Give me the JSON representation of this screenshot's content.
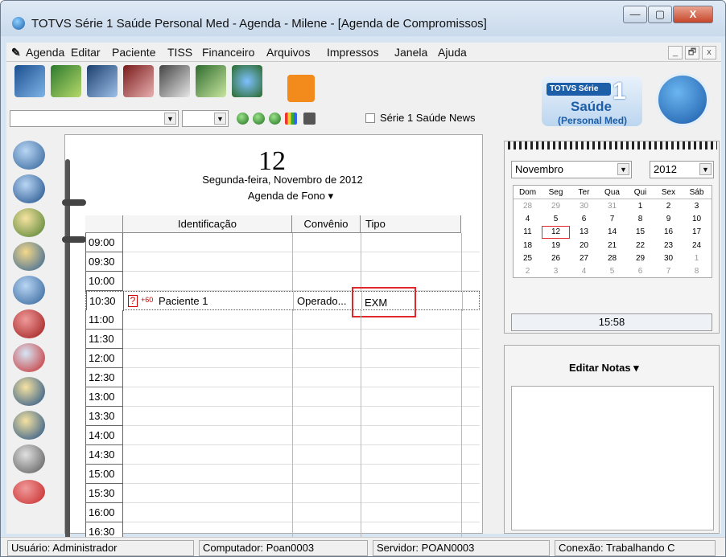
{
  "window": {
    "title": "TOTVS Série 1 Saúde Personal Med - Agenda - Milene - [Agenda de Compromissos]"
  },
  "window_buttons": {
    "minimize": "—",
    "maximize": "▢",
    "close": "X"
  },
  "menubar": {
    "items": [
      "Agenda",
      "Editar",
      "Paciente",
      "TISS",
      "Financeiro",
      "Arquivos",
      "Impressos",
      "Janela",
      "Ajuda"
    ],
    "mdi": [
      "_",
      "🗗",
      "x"
    ]
  },
  "toolbar": {
    "news_label": "Série 1 Saúde News"
  },
  "logo": {
    "brand": "TOTVS Série",
    "number": "1",
    "product": "Saúde",
    "edition": "(Personal Med)"
  },
  "agenda": {
    "day_number": "12",
    "day_text": "Segunda-feira, Novembro de 2012",
    "agenda_name": "Agenda de Fono ▾",
    "columns": [
      "Identificação",
      "Convênio",
      "Tipo"
    ],
    "rows": [
      {
        "time": "09:00"
      },
      {
        "time": "09:30"
      },
      {
        "time": "10:00"
      },
      {
        "time": "10:30",
        "flag": "?",
        "duration": "+60",
        "patient": "Paciente 1",
        "convenio": "Operado...",
        "tipo": "EXM"
      },
      {
        "time": "11:00"
      },
      {
        "time": "11:30"
      },
      {
        "time": "12:00"
      },
      {
        "time": "12:30"
      },
      {
        "time": "13:00"
      },
      {
        "time": "13:30"
      },
      {
        "time": "14:00"
      },
      {
        "time": "14:30"
      },
      {
        "time": "15:00"
      },
      {
        "time": "15:30"
      },
      {
        "time": "16:00"
      },
      {
        "time": "16:30"
      }
    ]
  },
  "calendar": {
    "month": "Novembro",
    "year": "2012",
    "weekdays": [
      "Dom",
      "Seg",
      "Ter",
      "Qua",
      "Qui",
      "Sex",
      "Sáb"
    ],
    "weeks": [
      [
        "28",
        "29",
        "30",
        "31",
        "1",
        "2",
        "3"
      ],
      [
        "4",
        "5",
        "6",
        "7",
        "8",
        "9",
        "10"
      ],
      [
        "11",
        "12",
        "13",
        "14",
        "15",
        "16",
        "17"
      ],
      [
        "18",
        "19",
        "20",
        "21",
        "22",
        "23",
        "24"
      ],
      [
        "25",
        "26",
        "27",
        "28",
        "29",
        "30",
        "1"
      ],
      [
        "2",
        "3",
        "4",
        "5",
        "6",
        "7",
        "8"
      ]
    ],
    "selected": "12",
    "time": "15:58"
  },
  "notes": {
    "title": "Editar Notas ▾"
  },
  "status": {
    "user": "Usuário: Administrador",
    "computer": "Computador: Poan0003",
    "server": "Servidor: POAN0003",
    "connection": "Conexão: Trabalhando C"
  }
}
